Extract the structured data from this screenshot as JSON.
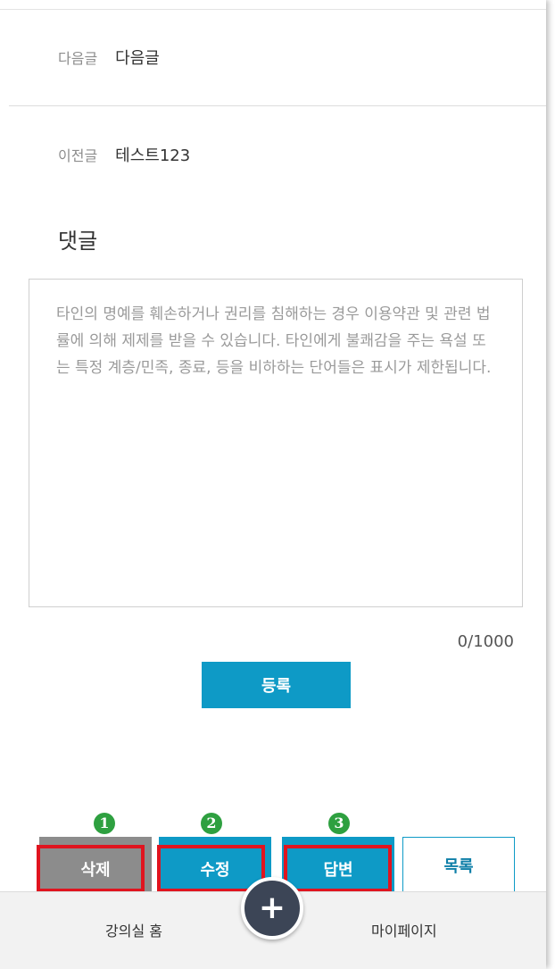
{
  "navigation": {
    "next": {
      "key": "다음글",
      "value": "다음글"
    },
    "prev": {
      "key": "이전글",
      "value": "테스트123"
    }
  },
  "comments": {
    "title": "댓글",
    "placeholder": "타인의 명예를 훼손하거나 권리를 침해하는 경우 이용약관 및 관련 법률에 의해 제제를 받을 수 있습니다. 타인에게 불쾌감을 주는 욕설 또는 특정 계층/민족, 종료, 등을 비하하는 단어들은 표시가 제한됩니다.",
    "count": "0/1000",
    "submit_label": "등록"
  },
  "actions": {
    "delete_label": "삭제",
    "edit_label": "수정",
    "reply_label": "답변",
    "list_label": "목록"
  },
  "markers": [
    "1",
    "2",
    "3"
  ],
  "bottom_nav": {
    "home_label": "강의실 홈",
    "mypage_label": "마이페이지",
    "fab_icon": "plus-icon"
  },
  "colors": {
    "accent": "#0e9ac6",
    "delete_gray": "#8c8c8c",
    "highlight_red": "#e0141f",
    "marker_green": "#2ea040",
    "fab_dark": "#3c4556"
  }
}
